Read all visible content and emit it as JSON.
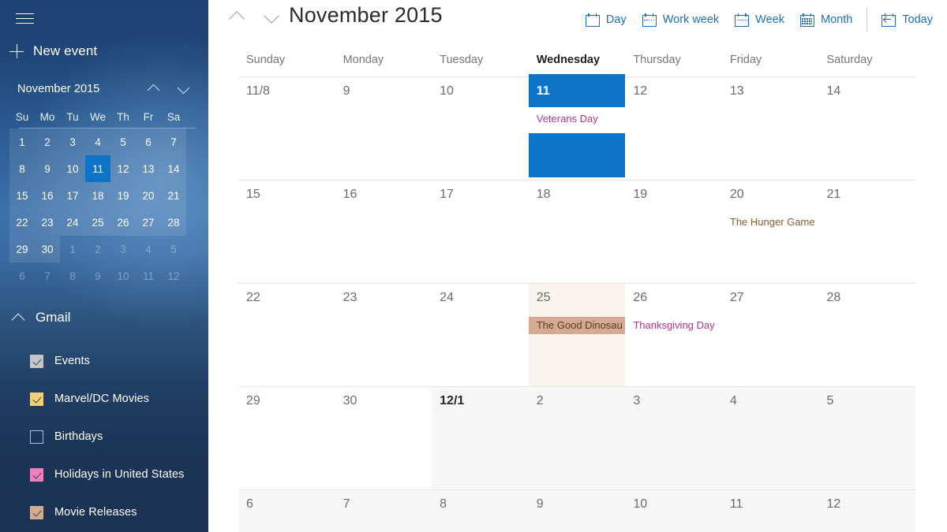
{
  "sidebar": {
    "menu_icon": "hamburger-icon",
    "new_event_label": "New event",
    "new_event_icon": "plus-icon",
    "mini_calendar": {
      "title": "November 2015",
      "prev_icon": "chevron-up-icon",
      "next_icon": "chevron-down-icon",
      "dow": [
        "Su",
        "Mo",
        "Tu",
        "We",
        "Th",
        "Fr",
        "Sa"
      ],
      "weeks": [
        [
          {
            "n": "1",
            "cls": "in-month"
          },
          {
            "n": "2",
            "cls": "in-month"
          },
          {
            "n": "3",
            "cls": "in-month"
          },
          {
            "n": "4",
            "cls": "in-month"
          },
          {
            "n": "5",
            "cls": "in-month"
          },
          {
            "n": "6",
            "cls": "in-month"
          },
          {
            "n": "7",
            "cls": "in-month"
          }
        ],
        [
          {
            "n": "8",
            "cls": "in-month"
          },
          {
            "n": "9",
            "cls": "in-month"
          },
          {
            "n": "10",
            "cls": "in-month"
          },
          {
            "n": "11",
            "cls": "in-month today"
          },
          {
            "n": "12",
            "cls": "in-month"
          },
          {
            "n": "13",
            "cls": "in-month"
          },
          {
            "n": "14",
            "cls": "in-month"
          }
        ],
        [
          {
            "n": "15",
            "cls": "in-month"
          },
          {
            "n": "16",
            "cls": "in-month"
          },
          {
            "n": "17",
            "cls": "in-month"
          },
          {
            "n": "18",
            "cls": "in-month"
          },
          {
            "n": "19",
            "cls": "in-month"
          },
          {
            "n": "20",
            "cls": "in-month"
          },
          {
            "n": "21",
            "cls": "in-month"
          }
        ],
        [
          {
            "n": "22",
            "cls": "in-month"
          },
          {
            "n": "23",
            "cls": "in-month"
          },
          {
            "n": "24",
            "cls": "in-month"
          },
          {
            "n": "25",
            "cls": "in-month"
          },
          {
            "n": "26",
            "cls": "in-month"
          },
          {
            "n": "27",
            "cls": "in-month"
          },
          {
            "n": "28",
            "cls": "in-month"
          }
        ],
        [
          {
            "n": "29",
            "cls": "in-month"
          },
          {
            "n": "30",
            "cls": "in-month"
          },
          {
            "n": "1",
            "cls": "out-month"
          },
          {
            "n": "2",
            "cls": "out-month"
          },
          {
            "n": "3",
            "cls": "out-month"
          },
          {
            "n": "4",
            "cls": "out-month"
          },
          {
            "n": "5",
            "cls": "out-month"
          }
        ],
        [
          {
            "n": "6",
            "cls": "out-month"
          },
          {
            "n": "7",
            "cls": "out-month"
          },
          {
            "n": "8",
            "cls": "out-month"
          },
          {
            "n": "9",
            "cls": "out-month"
          },
          {
            "n": "10",
            "cls": "out-month"
          },
          {
            "n": "11",
            "cls": "out-month"
          },
          {
            "n": "12",
            "cls": "out-month"
          }
        ]
      ]
    },
    "account": {
      "name": "Gmail",
      "collapse_icon": "chevron-up-icon",
      "calendars": [
        {
          "label": "Events",
          "checked": true,
          "color": "#c3c7cb"
        },
        {
          "label": "Marvel/DC Movies",
          "checked": true,
          "color": "#f3cf7c"
        },
        {
          "label": "Birthdays",
          "checked": false,
          "color": "transparent"
        },
        {
          "label": "Holidays in United States",
          "checked": true,
          "color": "#ee80c0"
        },
        {
          "label": "Movie Releases",
          "checked": true,
          "color": "#d3ab8e"
        }
      ]
    }
  },
  "header": {
    "prev_icon": "chevron-up-icon",
    "next_icon": "chevron-down-icon",
    "period_title": "November 2015",
    "views": [
      {
        "label": "Day",
        "icon": "calendar-day-icon"
      },
      {
        "label": "Work week",
        "icon": "calendar-workweek-icon"
      },
      {
        "label": "Week",
        "icon": "calendar-week-icon"
      },
      {
        "label": "Month",
        "icon": "calendar-month-icon"
      }
    ],
    "today": {
      "label": "Today",
      "icon": "calendar-today-icon"
    }
  },
  "grid": {
    "day_headers": [
      "Sunday",
      "Monday",
      "Tuesday",
      "Wednesday",
      "Thursday",
      "Friday",
      "Saturday"
    ],
    "today_header_index": 3,
    "weeks": [
      {
        "days": [
          {
            "num": "11/8",
            "state": "current"
          },
          {
            "num": "9",
            "state": "current"
          },
          {
            "num": "10",
            "state": "current"
          },
          {
            "num": "11",
            "state": "today",
            "selected": true,
            "events": [
              {
                "title": "Veterans Day",
                "style": "text",
                "color": "#b5348c"
              }
            ]
          },
          {
            "num": "12",
            "state": "current"
          },
          {
            "num": "13",
            "state": "current"
          },
          {
            "num": "14",
            "state": "current"
          }
        ]
      },
      {
        "days": [
          {
            "num": "15",
            "state": "current"
          },
          {
            "num": "16",
            "state": "current"
          },
          {
            "num": "17",
            "state": "current"
          },
          {
            "num": "18",
            "state": "current"
          },
          {
            "num": "19",
            "state": "current"
          },
          {
            "num": "20",
            "state": "current",
            "events": [
              {
                "title": "The Hunger Game",
                "style": "text",
                "color": "#8c5a33"
              }
            ]
          },
          {
            "num": "21",
            "state": "current"
          }
        ]
      },
      {
        "days": [
          {
            "num": "22",
            "state": "current"
          },
          {
            "num": "23",
            "state": "current"
          },
          {
            "num": "24",
            "state": "current"
          },
          {
            "num": "25",
            "state": "current",
            "hover": true,
            "events": [
              {
                "title": "The Good Dinosau",
                "style": "block",
                "color": "#5b3b24",
                "bg": "#d4ab92"
              }
            ]
          },
          {
            "num": "26",
            "state": "current",
            "events": [
              {
                "title": "Thanksgiving Day",
                "style": "text",
                "color": "#b5348c"
              }
            ]
          },
          {
            "num": "27",
            "state": "current"
          },
          {
            "num": "28",
            "state": "current"
          }
        ]
      },
      {
        "days": [
          {
            "num": "29",
            "state": "current"
          },
          {
            "num": "30",
            "state": "current"
          },
          {
            "num": "12/1",
            "state": "other",
            "emph": true
          },
          {
            "num": "2",
            "state": "other"
          },
          {
            "num": "3",
            "state": "other"
          },
          {
            "num": "4",
            "state": "other"
          },
          {
            "num": "5",
            "state": "other"
          }
        ]
      },
      {
        "days": [
          {
            "num": "6",
            "state": "other"
          },
          {
            "num": "7",
            "state": "other"
          },
          {
            "num": "8",
            "state": "other"
          },
          {
            "num": "9",
            "state": "other"
          },
          {
            "num": "10",
            "state": "other"
          },
          {
            "num": "11",
            "state": "other"
          },
          {
            "num": "12",
            "state": "other"
          }
        ]
      }
    ]
  },
  "colors": {
    "accent_blue": "#0d74c8",
    "link_blue": "#1b6fc4",
    "holiday_pink": "#b5348c",
    "movie_brown": "#8c5a33",
    "movie_block_bg": "#d4ab92",
    "hover_cream": "#faf4ef",
    "other_month_gray": "#f7f7f7"
  }
}
